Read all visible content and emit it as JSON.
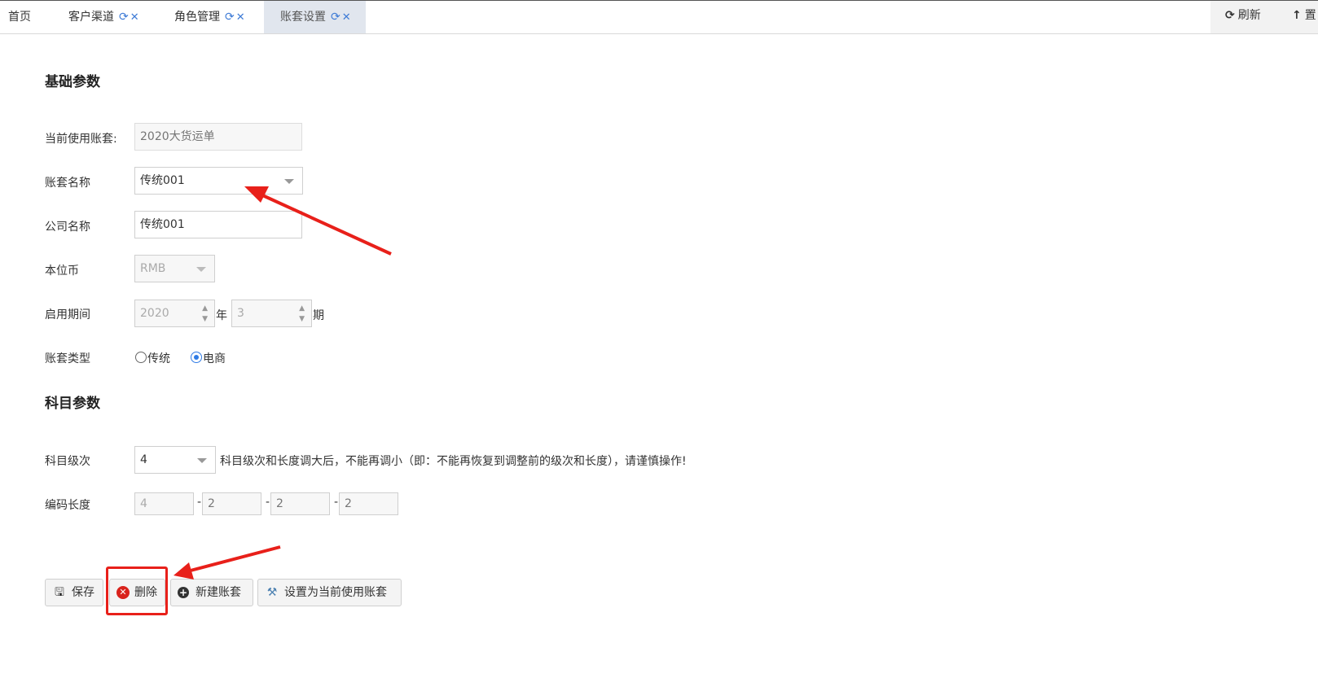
{
  "tabs": [
    {
      "label": "首页"
    },
    {
      "label": "客户渠道"
    },
    {
      "label": "角色管理"
    },
    {
      "label": "账套设置"
    }
  ],
  "toolbar": {
    "refresh_label": "刷新",
    "top_label": "置"
  },
  "sections": {
    "basic": "基础参数",
    "subject": "科目参数"
  },
  "form": {
    "current_account": {
      "label": "当前使用账套:",
      "placeholder": "2020大货运单"
    },
    "account_name": {
      "label": "账套名称",
      "value": "传统001"
    },
    "company_name": {
      "label": "公司名称",
      "value": "传统001"
    },
    "currency": {
      "label": "本位币",
      "value": "RMB"
    },
    "period": {
      "label": "启用期间",
      "year": "2020",
      "year_unit": "年",
      "period": "3",
      "period_unit": "期"
    },
    "account_type": {
      "label": "账套类型",
      "options": [
        "传统",
        "电商"
      ],
      "selected": "电商"
    },
    "subject_level": {
      "label": "科目级次",
      "value": "4",
      "note": "科目级次和长度调大后，不能再调小（即：不能再恢复到调整前的级次和长度），请谨慎操作!"
    },
    "code_length": {
      "label": "编码长度",
      "values": [
        "4",
        "2",
        "2",
        "2"
      ],
      "separator": "-"
    }
  },
  "buttons": {
    "save": "保存",
    "delete": "删除",
    "new": "新建账套",
    "set_current": "设置为当前使用账套"
  },
  "colors": {
    "accent": "#3e7bd6",
    "annotation": "#e8201a",
    "active_tab": "#e1e6ee"
  }
}
